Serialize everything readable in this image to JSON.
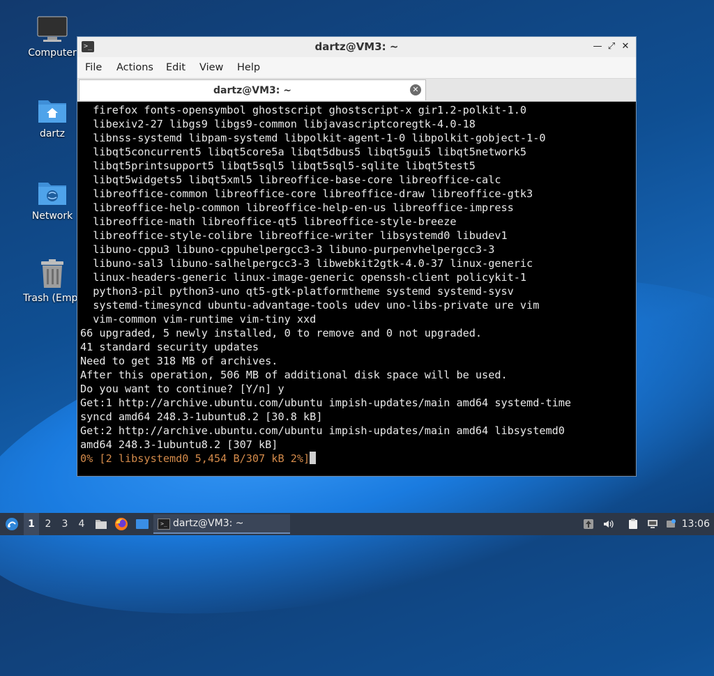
{
  "desktop": {
    "icons": [
      {
        "label": "Computer"
      },
      {
        "label": "dartz"
      },
      {
        "label": "Network"
      },
      {
        "label": "Trash (Empt"
      }
    ]
  },
  "window": {
    "title": "dartz@VM3: ~",
    "menu": [
      "File",
      "Actions",
      "Edit",
      "View",
      "Help"
    ],
    "tab": {
      "label": "dartz@VM3: ~"
    },
    "terminal": {
      "lines": [
        "  firefox fonts-opensymbol ghostscript ghostscript-x gir1.2-polkit-1.0",
        "  libexiv2-27 libgs9 libgs9-common libjavascriptcoregtk-4.0-18",
        "  libnss-systemd libpam-systemd libpolkit-agent-1-0 libpolkit-gobject-1-0",
        "  libqt5concurrent5 libqt5core5a libqt5dbus5 libqt5gui5 libqt5network5",
        "  libqt5printsupport5 libqt5sql5 libqt5sql5-sqlite libqt5test5",
        "  libqt5widgets5 libqt5xml5 libreoffice-base-core libreoffice-calc",
        "  libreoffice-common libreoffice-core libreoffice-draw libreoffice-gtk3",
        "  libreoffice-help-common libreoffice-help-en-us libreoffice-impress",
        "  libreoffice-math libreoffice-qt5 libreoffice-style-breeze",
        "  libreoffice-style-colibre libreoffice-writer libsystemd0 libudev1",
        "  libuno-cppu3 libuno-cppuhelpergcc3-3 libuno-purpenvhelpergcc3-3",
        "  libuno-sal3 libuno-salhelpergcc3-3 libwebkit2gtk-4.0-37 linux-generic",
        "  linux-headers-generic linux-image-generic openssh-client policykit-1",
        "  python3-pil python3-uno qt5-gtk-platformtheme systemd systemd-sysv",
        "  systemd-timesyncd ubuntu-advantage-tools udev uno-libs-private ure vim",
        "  vim-common vim-runtime vim-tiny xxd",
        "66 upgraded, 5 newly installed, 0 to remove and 0 not upgraded.",
        "41 standard security updates",
        "Need to get 318 MB of archives.",
        "After this operation, 506 MB of additional disk space will be used.",
        "Do you want to continue? [Y/n] y",
        "Get:1 http://archive.ubuntu.com/ubuntu impish-updates/main amd64 systemd-time",
        "syncd amd64 248.3-1ubuntu8.2 [30.8 kB]",
        "Get:2 http://archive.ubuntu.com/ubuntu impish-updates/main amd64 libsystemd0",
        "amd64 248.3-1ubuntu8.2 [307 kB]"
      ],
      "progress": "0% [2 libsystemd0 5,454 B/307 kB 2%]"
    }
  },
  "taskbar": {
    "workspaces": [
      "1",
      "2",
      "3",
      "4"
    ],
    "task_label": "dartz@VM3: ~",
    "clock": "13:06"
  }
}
